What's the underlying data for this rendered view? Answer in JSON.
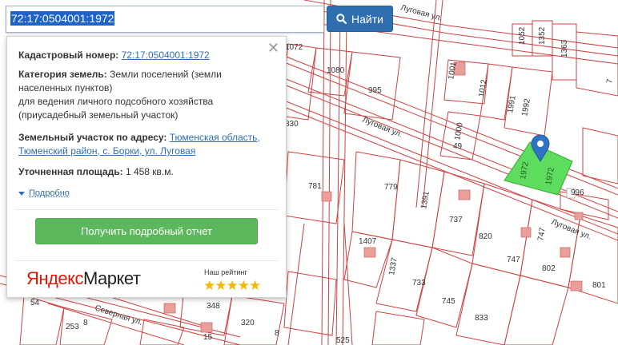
{
  "search": {
    "value": "72:17:0504001:1972",
    "button_label": "Найти"
  },
  "popup": {
    "cadastral_label": "Кадастровый номер:",
    "cadastral_value": "72:17:0504001:1972",
    "category_label": "Категория земель:",
    "category_line1": "Земли поселений (земли",
    "category_line2": "населенных пунктов)",
    "category_line3": "для ведения личного подсобного хозяйства",
    "category_line4": "(приусадебный земельный участок)",
    "address_label": "Земельный участок по адресу:",
    "address_line1": "Тюменская область,",
    "address_line2": "Тюменский район, с. Борки, ул. Луговая",
    "area_label": "Уточненная площадь:",
    "area_value": "1 458 кв.м.",
    "more_label": "Подробно",
    "report_button": "Получить подробный отчет",
    "brand_part1": "Яндекс",
    "brand_part2": "Маркет",
    "rating_label": "Наш рейтинг",
    "stars": "★★★★★"
  },
  "map": {
    "streets": [
      "Луговая ул.",
      "Луговая ул.",
      "Луговая ул.",
      "Северная ул."
    ],
    "parcel_labels": [
      "1052",
      "1352",
      "1072",
      "1363",
      "1080",
      "995",
      "1001",
      "1012",
      "1991",
      "1992",
      "830",
      "1000",
      "49",
      "1972",
      "1972",
      "996",
      "781",
      "779",
      "1391",
      "737",
      "820",
      "747",
      "747",
      "1407",
      "1337",
      "733",
      "802",
      "801",
      "745",
      "833",
      "348",
      "320",
      "8",
      "15",
      "525",
      "54",
      "253",
      "8",
      "7"
    ],
    "colors": {
      "parcel_line": "#d04040",
      "selected_fill": "#5ddc5d",
      "selected_border": "#2fae2f",
      "marker": "#2f74c4",
      "building": "#e9a09a"
    }
  }
}
